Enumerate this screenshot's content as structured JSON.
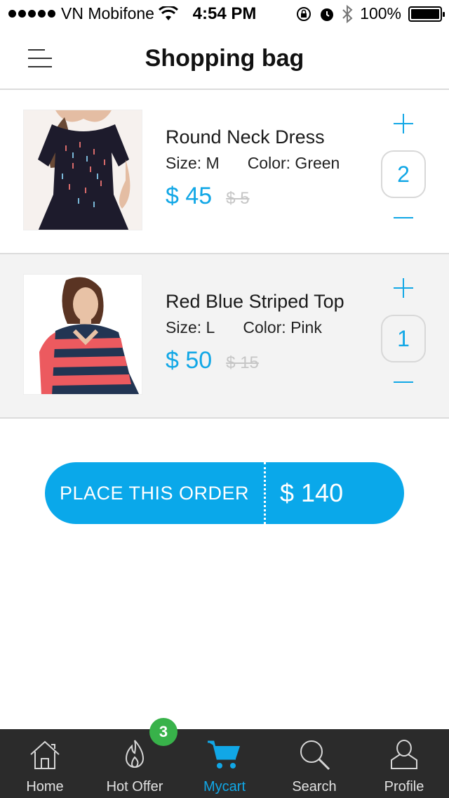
{
  "status_bar": {
    "carrier": "VN Mobifone",
    "time": "4:54 PM",
    "battery": "100%"
  },
  "header": {
    "title": "Shopping bag",
    "menu_icon": "menu-icon"
  },
  "cart": {
    "items": [
      {
        "name": "Round Neck Dress",
        "size": "Size: M",
        "color": "Color: Green",
        "price": "$ 45",
        "old_price": "$ 5",
        "quantity": "2",
        "image": "dress-photo"
      },
      {
        "name": "Red Blue Striped Top",
        "size": "Size: L",
        "color": "Color: Pink",
        "price": "$ 50",
        "old_price": "$ 15",
        "quantity": "1",
        "image": "striped-top-photo"
      }
    ]
  },
  "order": {
    "label": "PLACE THIS ORDER",
    "total": "$ 140"
  },
  "tab_bar": {
    "tabs": [
      {
        "label": "Home",
        "icon": "home-icon"
      },
      {
        "label": "Hot Offer",
        "icon": "flame-icon"
      },
      {
        "label": "Mycart",
        "icon": "cart-icon",
        "badge": "3",
        "active": true
      },
      {
        "label": "Search",
        "icon": "search-icon"
      },
      {
        "label": "Profile",
        "icon": "profile-icon"
      }
    ]
  },
  "colors": {
    "accent": "#11a7e6",
    "badge": "#38b24a",
    "tab_bar_bg": "#2b2b2b"
  }
}
